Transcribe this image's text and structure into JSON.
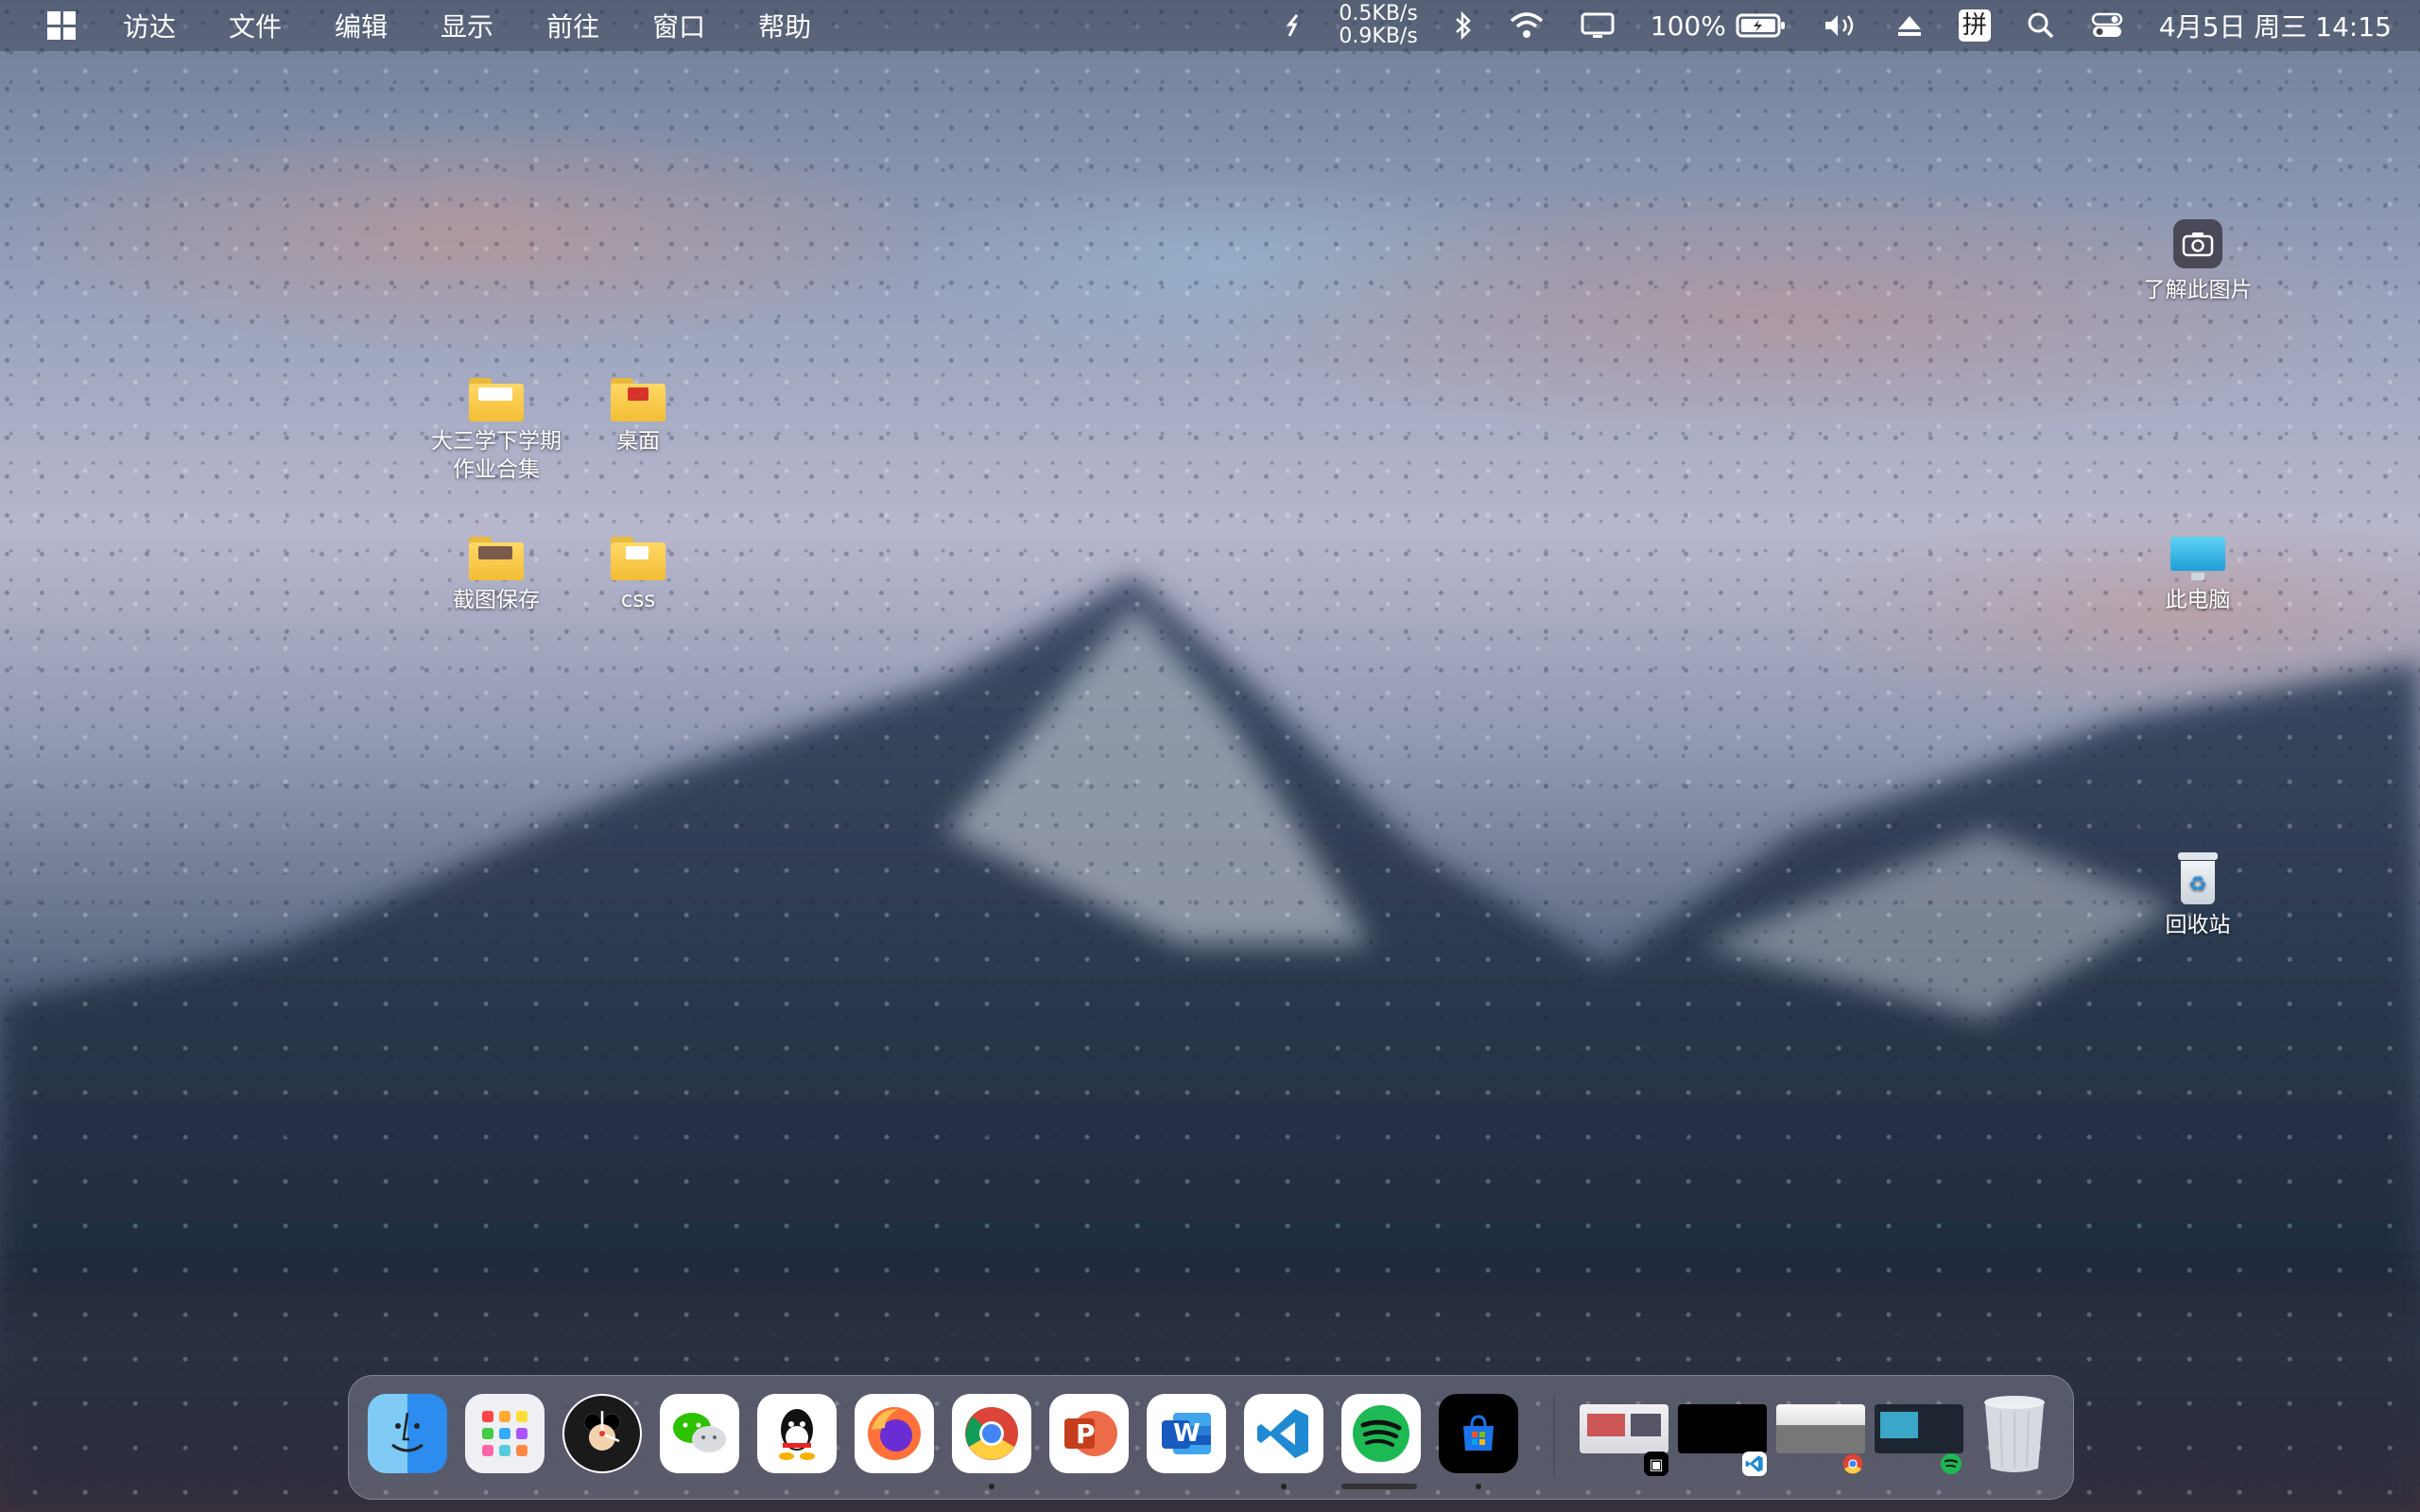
{
  "menubar": {
    "items": [
      "访达",
      "文件",
      "编辑",
      "显示",
      "前往",
      "窗口",
      "帮助"
    ],
    "net_up": "0.5KB/s",
    "net_down": "0.9KB/s",
    "battery": "100%",
    "ime": "拼",
    "datetime": "4月5日 周三 14:15"
  },
  "desktop": {
    "folder_homework": {
      "line1": "大三学下学期",
      "line2": "作业合集"
    },
    "folder_desktop": "桌面",
    "folder_screenshots": "截图保存",
    "folder_css": "css",
    "learn_image": "了解此图片",
    "this_pc": "此电脑",
    "recycle_bin": "回收站"
  },
  "dock": {
    "apps": [
      "finder-icon",
      "launchpad-icon",
      "clock-icon",
      "wechat-icon",
      "qq-icon",
      "firefox-icon",
      "chrome-icon",
      "powerpoint-icon",
      "word-icon",
      "vscode-icon",
      "spotify-icon",
      "store-icon"
    ],
    "word_letter": "W",
    "ppt_letter": "P"
  },
  "colors": {
    "folder": "#f3bd34",
    "vscode": "#1f8ad2",
    "spotify": "#1db954",
    "chrome_red": "#db4437"
  }
}
